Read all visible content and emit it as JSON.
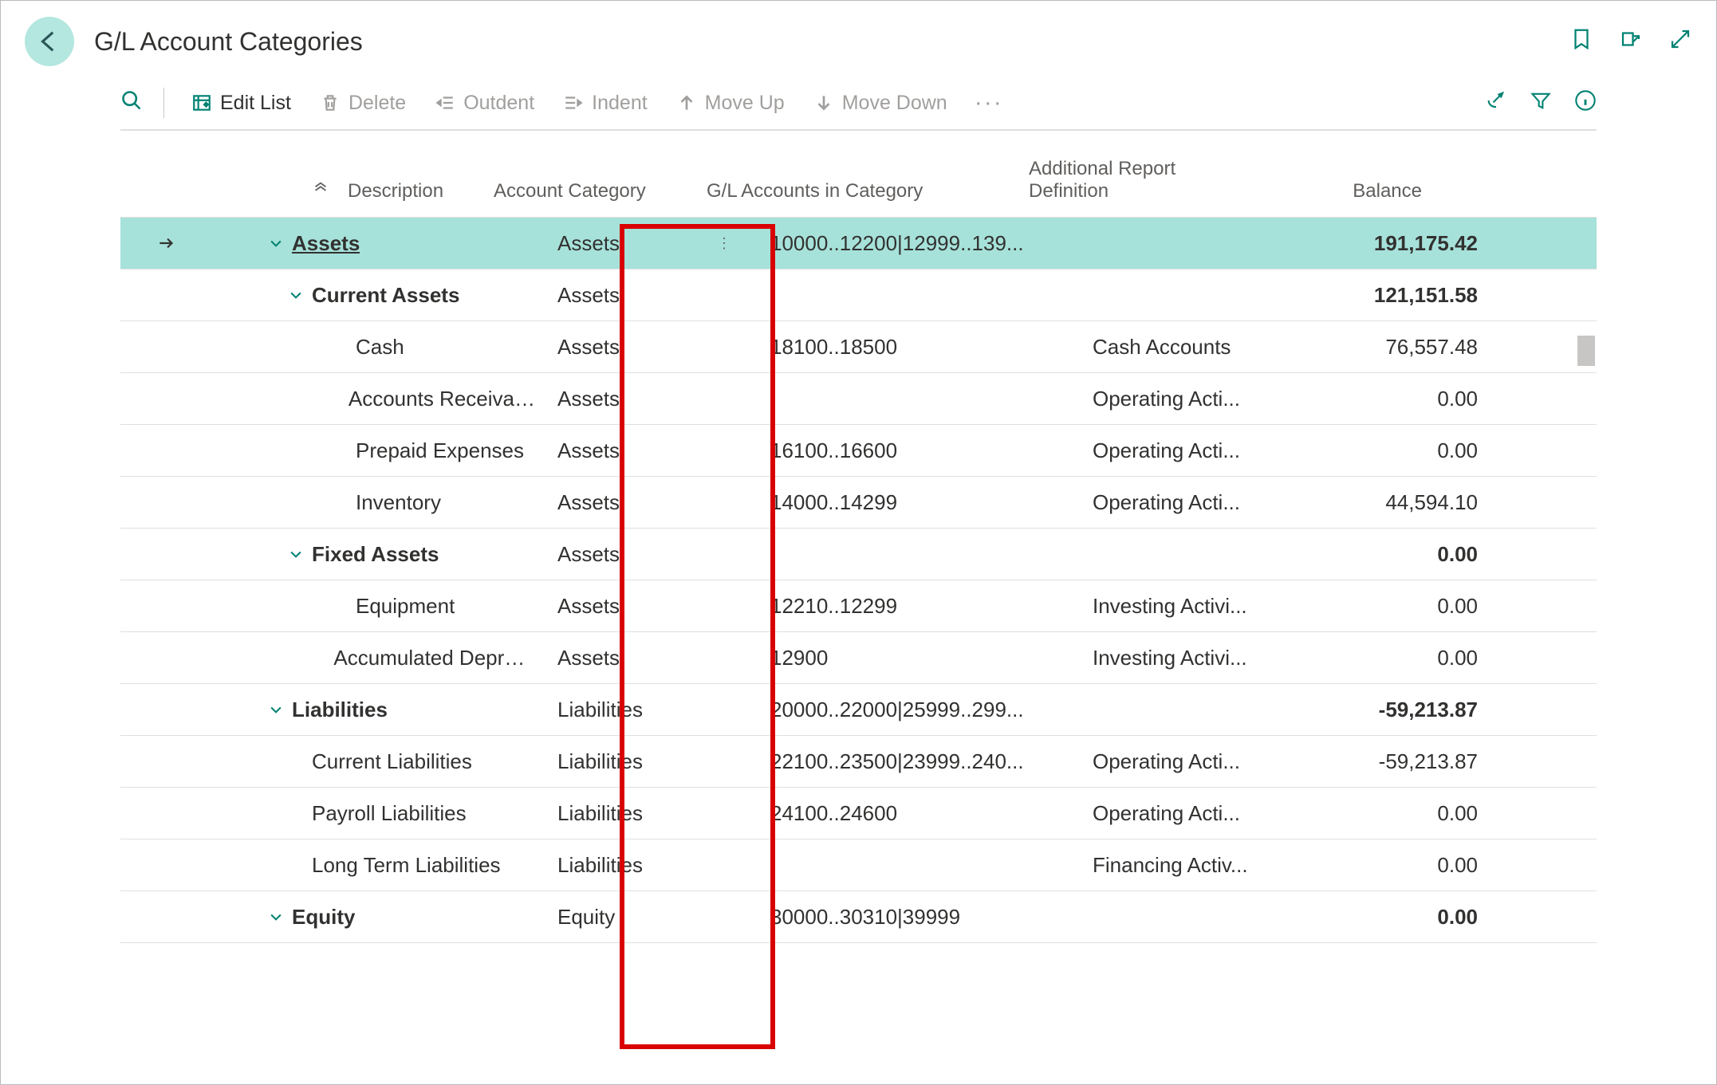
{
  "page_title": "G/L Account Categories",
  "toolbar": {
    "edit_list": "Edit List",
    "delete": "Delete",
    "outdent": "Outdent",
    "indent": "Indent",
    "move_up": "Move Up",
    "move_down": "Move Down"
  },
  "columns": {
    "description": "Description",
    "account_category": "Account Category",
    "gl_accounts": "G/L Accounts in Category",
    "additional_report": "Additional Report Definition",
    "balance": "Balance"
  },
  "rows": [
    {
      "selected": true,
      "bold": true,
      "indent": 0,
      "expand": true,
      "desc": "Assets",
      "cat": "Assets",
      "accts": "10000..12200|12999..139...",
      "addl": "",
      "bal": "191,175.42"
    },
    {
      "bold": true,
      "indent": 1,
      "expand": true,
      "desc": "Current Assets",
      "cat": "Assets",
      "accts": "",
      "addl": "",
      "bal": "121,151.58"
    },
    {
      "indent": 2,
      "desc": "Cash",
      "cat": "Assets",
      "accts": "18100..18500",
      "addl": "Cash Accounts",
      "bal": "76,557.48"
    },
    {
      "indent": 2,
      "desc": "Accounts Receivable",
      "cat": "Assets",
      "accts": "",
      "addl": "Operating Acti...",
      "bal": "0.00"
    },
    {
      "indent": 2,
      "desc": "Prepaid Expenses",
      "cat": "Assets",
      "accts": "16100..16600",
      "addl": "Operating Acti...",
      "bal": "0.00"
    },
    {
      "indent": 2,
      "desc": "Inventory",
      "cat": "Assets",
      "accts": "14000..14299",
      "addl": "Operating Acti...",
      "bal": "44,594.10"
    },
    {
      "bold": true,
      "indent": 1,
      "expand": true,
      "desc": "Fixed Assets",
      "cat": "Assets",
      "accts": "",
      "addl": "",
      "bal": "0.00"
    },
    {
      "indent": 2,
      "desc": "Equipment",
      "cat": "Assets",
      "accts": "12210..12299",
      "addl": "Investing Activi...",
      "bal": "0.00"
    },
    {
      "indent": 2,
      "desc": "Accumulated Deprecia...",
      "cat": "Assets",
      "accts": "12900",
      "addl": "Investing Activi...",
      "bal": "0.00"
    },
    {
      "bold": true,
      "indent": 0,
      "expand": true,
      "desc": "Liabilities",
      "cat": "Liabilities",
      "accts": "20000..22000|25999..299...",
      "addl": "",
      "bal": "-59,213.87"
    },
    {
      "indent": 1,
      "desc": "Current Liabilities",
      "cat": "Liabilities",
      "accts": "22100..23500|23999..240...",
      "addl": "Operating Acti...",
      "bal": "-59,213.87"
    },
    {
      "indent": 1,
      "desc": "Payroll Liabilities",
      "cat": "Liabilities",
      "accts": "24100..24600",
      "addl": "Operating Acti...",
      "bal": "0.00"
    },
    {
      "indent": 1,
      "desc": "Long Term Liabilities",
      "cat": "Liabilities",
      "accts": "",
      "addl": "Financing Activ...",
      "bal": "0.00"
    },
    {
      "bold": true,
      "indent": 0,
      "expand": true,
      "desc": "Equity",
      "cat": "Equity",
      "accts": "30000..30310|39999",
      "addl": "",
      "bal": "0.00"
    }
  ]
}
